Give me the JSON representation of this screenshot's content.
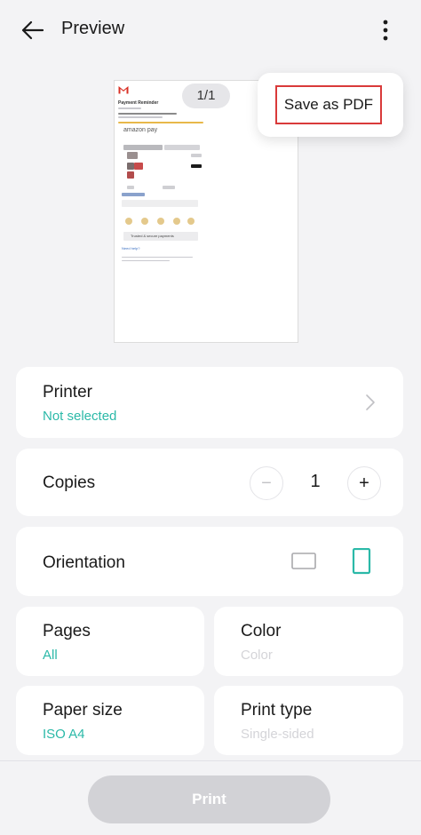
{
  "header": {
    "title": "Preview"
  },
  "preview": {
    "page_indicator": "1/1",
    "doc": {
      "heading": "Payment Reminder",
      "brand": "amazon pay",
      "footer_button": "Trusted & secure payments",
      "link": "Need help?"
    }
  },
  "menu": {
    "items": [
      {
        "label": "Save as PDF"
      }
    ]
  },
  "settings": {
    "printer": {
      "label": "Printer",
      "value": "Not selected"
    },
    "copies": {
      "label": "Copies",
      "value": "1",
      "minus": "−",
      "plus": "+"
    },
    "orientation": {
      "label": "Orientation"
    },
    "pages": {
      "label": "Pages",
      "value": "All"
    },
    "color": {
      "label": "Color",
      "value": "Color"
    },
    "paper_size": {
      "label": "Paper size",
      "value": "ISO A4"
    },
    "print_type": {
      "label": "Print type",
      "value": "Single-sided"
    }
  },
  "footer": {
    "print_label": "Print"
  },
  "colors": {
    "accent": "#2bb9a8",
    "highlight_border": "#d93a3a",
    "disabled": "#d2d2d6"
  }
}
